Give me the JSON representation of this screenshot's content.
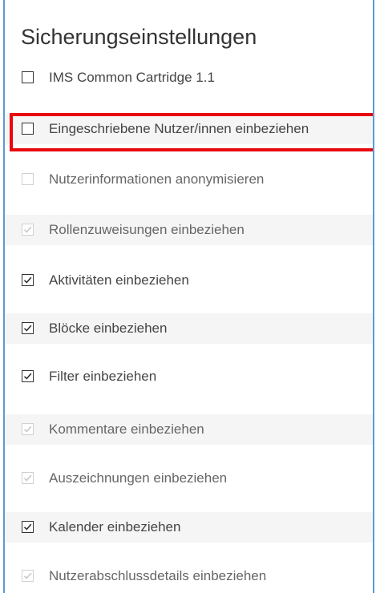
{
  "section_title": "Sicherungseinstellungen",
  "colors": {
    "frame_border": "#5b9bd5",
    "highlight_border": "#e8060f",
    "checkbox_border": "#333333",
    "checkbox_disabled": "#d0d0d0",
    "checkmark_disabled": "#c8c8c8"
  },
  "options": [
    {
      "label": "IMS Common Cartridge 1.1",
      "checked": false,
      "disabled": false,
      "highlighted": false
    },
    {
      "label": "Eingeschriebene Nutzer/innen einbeziehen",
      "checked": false,
      "disabled": false,
      "highlighted": true
    },
    {
      "label": "Nutzerinformationen anonymisieren",
      "checked": false,
      "disabled": true,
      "highlighted": false
    },
    {
      "label": "Rollenzuweisungen einbeziehen",
      "checked": true,
      "disabled": true,
      "highlighted": false
    },
    {
      "label": "Aktivitäten einbeziehen",
      "checked": true,
      "disabled": false,
      "highlighted": false
    },
    {
      "label": "Blöcke einbeziehen",
      "checked": true,
      "disabled": false,
      "highlighted": false
    },
    {
      "label": "Filter einbeziehen",
      "checked": true,
      "disabled": false,
      "highlighted": false
    },
    {
      "label": "Kommentare einbeziehen",
      "checked": true,
      "disabled": true,
      "highlighted": false
    },
    {
      "label": "Auszeichnungen einbeziehen",
      "checked": true,
      "disabled": true,
      "highlighted": false
    },
    {
      "label": "Kalender einbeziehen",
      "checked": true,
      "disabled": false,
      "highlighted": false
    },
    {
      "label": "Nutzerabschlussdetails einbeziehen",
      "checked": true,
      "disabled": true,
      "highlighted": false
    }
  ]
}
